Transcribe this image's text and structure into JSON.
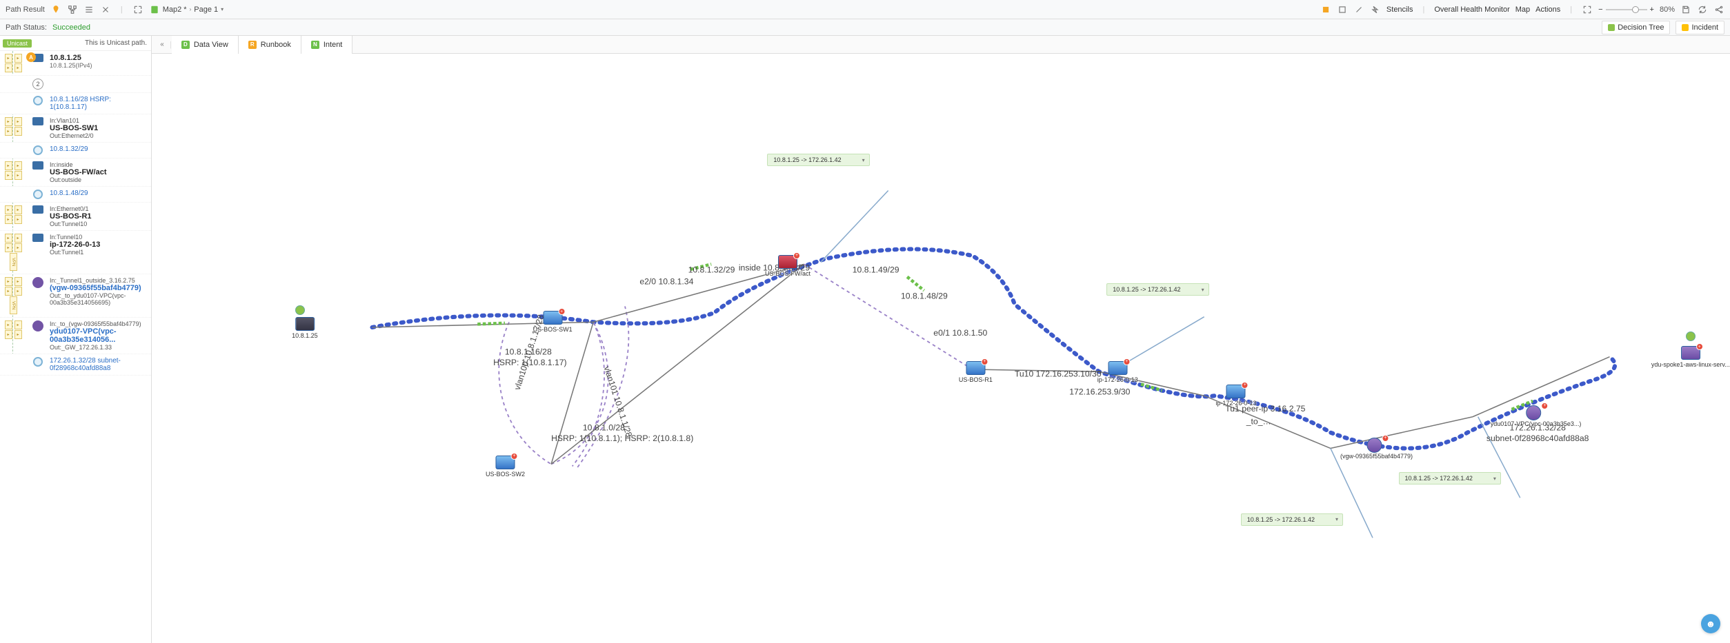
{
  "header": {
    "title": "Path Result",
    "map_name": "Map2 *",
    "page_name": "Page 1",
    "stencils": "Stencils",
    "ohm": "Overall Health Monitor",
    "map": "Map",
    "actions": "Actions",
    "zoom": "80%"
  },
  "subheader": {
    "status_label": "Path Status:",
    "status_value": "Succeeded",
    "decision_tree": "Decision Tree",
    "incident": "Incident"
  },
  "tabs": {
    "data_view": "Data View",
    "runbook": "Runbook",
    "intent": "Intent"
  },
  "sidebar": {
    "unicast_badge": "Unicast",
    "unicast_msg": "This is Unicast path.",
    "hops": [
      {
        "type": "source",
        "name": "10.8.1.25",
        "sub": "10.8.1.25(IPv4)",
        "badgeA": true
      },
      {
        "type": "count",
        "count": "2"
      },
      {
        "type": "line",
        "name": "10.8.1.16/28 HSRP: 1(10.8.1.17)"
      },
      {
        "type": "device",
        "in": "In:Vlan101",
        "name": "US-BOS-SW1",
        "out": "Out:Ethernet2/0"
      },
      {
        "type": "line",
        "name": "10.8.1.32/29"
      },
      {
        "type": "device",
        "in": "In:inside",
        "name": "US-BOS-FW/act",
        "out": "Out:outside"
      },
      {
        "type": "line",
        "name": "10.8.1.48/29"
      },
      {
        "type": "device",
        "in": "In:Ethernet0/1",
        "name": "US-BOS-R1",
        "out": "Out:Tunnel10"
      },
      {
        "type": "device",
        "in": "In:Tunnel10",
        "name": "ip-172-26-0-13",
        "out": "Out:Tunnel1",
        "vpn": true
      },
      {
        "type": "aws",
        "in": "In:_Tunnel1_outside_3.16.2.75",
        "name": "(vgw-09365f55baf4b4779)",
        "out": "Out:_to_ydu0107-VPC(vpc-00a3b35e314056695)",
        "vpn": true
      },
      {
        "type": "aws",
        "in": "In:_to_(vgw-09365f55baf4b4779)",
        "name": "ydu0107-VPC(vpc-00a3b35e314056...",
        "out": "Out:_GW_172.26.1.33"
      },
      {
        "type": "line",
        "name": "172.26.1.32/28 subnet-0f28968c40afd88a8"
      }
    ]
  },
  "canvas": {
    "nodes": {
      "src": {
        "label": "10.8.1.25"
      },
      "sw1": {
        "label": "US-BOS-SW1"
      },
      "sw2": {
        "label": "US-BOS-SW2"
      },
      "fw": {
        "label": "US-BOS-FW/act"
      },
      "r1": {
        "label": "US-BOS-R1"
      },
      "ip172": {
        "label": "ip-172-26-0-13"
      },
      "vgw": {
        "label": "(vgw-09365f55baf4b4779)"
      },
      "vpc": {
        "label": "ydu0107-VPC(vpc-00a3b35e3...)"
      },
      "dst": {
        "label": "ydu-spoke1-aws-linux-serv..."
      }
    },
    "link_labels": {
      "hsrp": "10.8.1.16/28\nHSRP: 1(10.8.1.17)",
      "e20": "e2/0 10.8.1.34",
      "seg32": "10.8.1.32/29",
      "inside": "inside 10.8.1.33/29",
      "seg49": "10.8.1.49/29",
      "seg48": "10.8.1.48/29",
      "e01": "e0/1 10.8.1.50",
      "tu10": "Tu10 172.16.253.10/30",
      "chg": "172.16.253.9/30",
      "tu1": "Tu1 peer-ip 3.16.2.75",
      "to": "_to_...",
      "sub28": "172.26.1.32/28\nsubnet-0f28968c40afd88a8",
      "sw2_top": "10.8.1.0/28",
      "sw2_sub": "HSRP: 1(10.8.1.1); HSRP: 2(10.8.1.8)",
      "vlan": "vlan101 10.8.1.1/28",
      "vlan2": "vlan100 10.8.1.17/28"
    },
    "callouts": {
      "c1": "10.8.1.25 -> 172.26.1.42",
      "c2": "10.8.1.25 -> 172.26.1.42",
      "c3": "10.8.1.25 -> 172.26.1.42",
      "c4": "10.8.1.25 -> 172.26.1.42"
    }
  }
}
